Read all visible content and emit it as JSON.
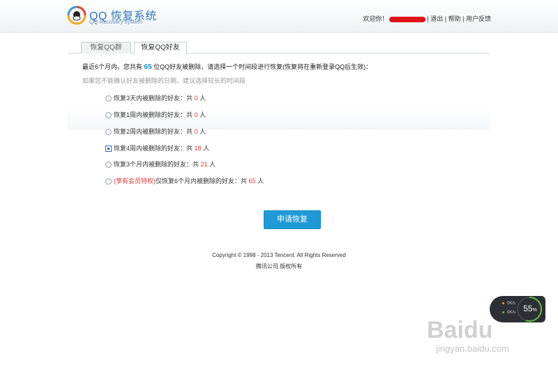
{
  "header": {
    "logo_title": "QQ 恢复系统",
    "logo_sub": "QQ Recovery system",
    "welcome": "欢迎你！",
    "logout": "退出",
    "help": "帮助",
    "feedback": "用户反馈",
    "sep": "|"
  },
  "tabs": [
    {
      "label": "恢复QQ群"
    },
    {
      "label": "恢复QQ好友"
    }
  ],
  "intro": {
    "prefix": "最近6个月内，您共有",
    "count": "65",
    "suffix": "位QQ好友被删除，请选择一个时间段进行恢复(恢复将在重新登录QQ后生效)："
  },
  "hint": "如果您不能确认好友被删除的日期，建议选择较长的时间段",
  "options": [
    {
      "label": "恢复3天内被删除的好友：共",
      "count": "0",
      "unit": "人"
    },
    {
      "label": "恢复1周内被删除的好友：共",
      "count": "0",
      "unit": "人"
    },
    {
      "label": "恢复2周内被删除的好友：共",
      "count": "0",
      "unit": "人"
    },
    {
      "label": "恢复4周内被删除的好友：共",
      "count": "18",
      "unit": "人"
    },
    {
      "label": "恢复3个月内被删除的好友：共",
      "count": "21",
      "unit": "人"
    },
    {
      "vip": "(享有会员特权)",
      "label": "仅恢复6个月内被删除的好友：共",
      "count": "65",
      "unit": "人"
    }
  ],
  "submit_label": "申请恢复",
  "footer": {
    "copyright": "Copyright © 1998 - 2013 Tencent. All Rights Reserved",
    "company": "腾讯公司 版权所有"
  },
  "widget": {
    "up": "0K/s",
    "down": "0K/s",
    "percent": "55",
    "percent_unit": "%",
    "percent_level": 0.55
  },
  "watermark": {
    "brand": "Baidu",
    "sub": "jingyan.baidu.com"
  }
}
